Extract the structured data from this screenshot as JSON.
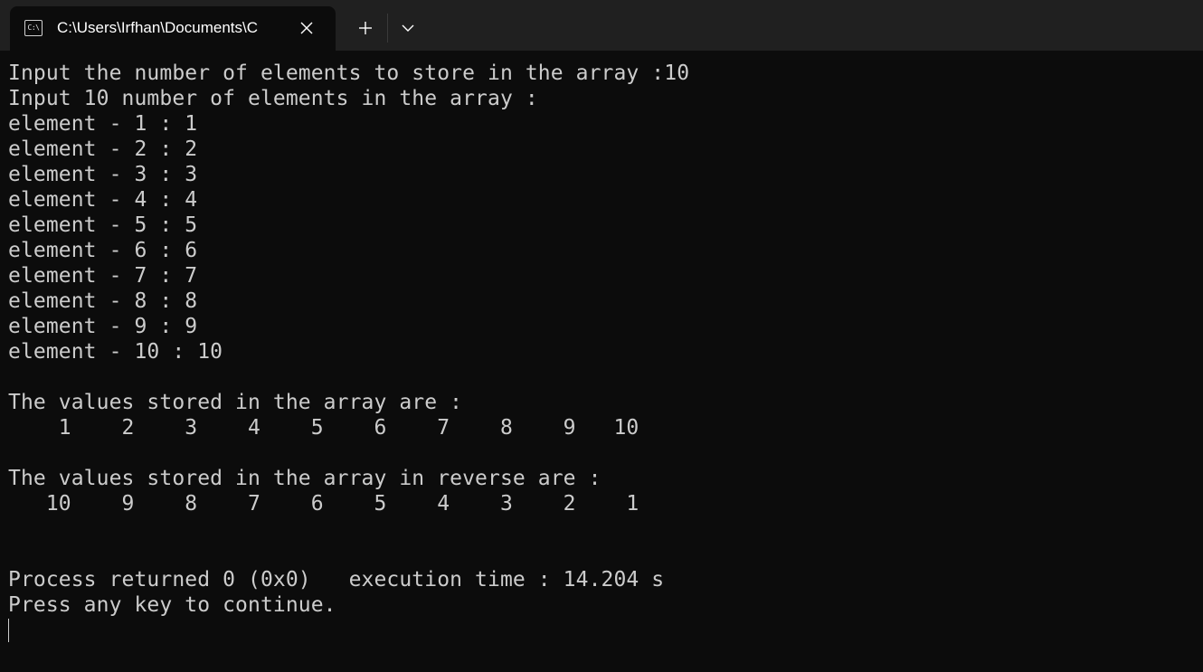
{
  "tab": {
    "title": "C:\\Users\\Irfhan\\Documents\\C",
    "icon": "console-icon",
    "icon_glyph": "C:\\"
  },
  "console": {
    "lines": [
      "Input the number of elements to store in the array :10",
      "Input 10 number of elements in the array :",
      "element - 1 : 1",
      "element - 2 : 2",
      "element - 3 : 3",
      "element - 4 : 4",
      "element - 5 : 5",
      "element - 6 : 6",
      "element - 7 : 7",
      "element - 8 : 8",
      "element - 9 : 9",
      "element - 10 : 10",
      "",
      "The values stored in the array are :",
      "    1    2    3    4    5    6    7    8    9   10",
      "",
      "The values stored in the array in reverse are :",
      "   10    9    8    7    6    5    4    3    2    1",
      "",
      "",
      "Process returned 0 (0x0)   execution time : 14.204 s",
      "Press any key to continue."
    ]
  },
  "colors": {
    "background": "#0c0c0c",
    "titlebar": "#202020",
    "text": "#cccccc"
  }
}
